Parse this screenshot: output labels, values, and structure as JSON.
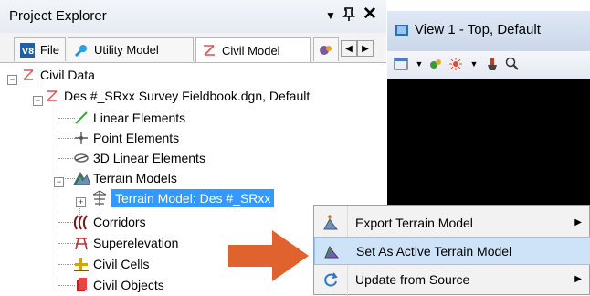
{
  "explorer": {
    "title": "Project Explorer",
    "controls": {
      "dropdown": "▼",
      "pin": "ᵩ",
      "close": "✕"
    },
    "tabs": [
      {
        "label": "File",
        "icon": "v8-icon"
      },
      {
        "label": "Utility Model",
        "icon": "utility-icon"
      },
      {
        "label": "Civil Model",
        "icon": "civil-icon"
      }
    ],
    "tree": {
      "root": "Civil Data",
      "file": "Des #_SRxx Survey Fieldbook.dgn, Default",
      "items": [
        {
          "label": "Linear Elements",
          "icon": "linear-icon"
        },
        {
          "label": "Point Elements",
          "icon": "point-icon"
        },
        {
          "label": "3D Linear Elements",
          "icon": "3d-linear-icon"
        },
        {
          "label": "Terrain Models",
          "icon": "terrain-models-icon"
        },
        {
          "label": "Terrain Model: Des #_SRxx",
          "icon": "terrain-model-icon"
        },
        {
          "label": "Corridors",
          "icon": "corridors-icon"
        },
        {
          "label": "Superelevation",
          "icon": "superelevation-icon"
        },
        {
          "label": "Civil Cells",
          "icon": "civil-cells-icon"
        },
        {
          "label": "Civil Objects",
          "icon": "civil-objects-icon"
        }
      ]
    }
  },
  "view": {
    "title": "View 1 - Top, Default"
  },
  "context_menu": {
    "items": [
      {
        "label": "Export Terrain Model",
        "submenu": "▶"
      },
      {
        "label": "Set As Active Terrain Model",
        "submenu": ""
      },
      {
        "label": "Update from Source",
        "submenu": "▶"
      }
    ]
  },
  "colors": {
    "selection": "#3399ff",
    "arrow": "#e0632f",
    "menu_highlight": "#cfe3f8"
  }
}
